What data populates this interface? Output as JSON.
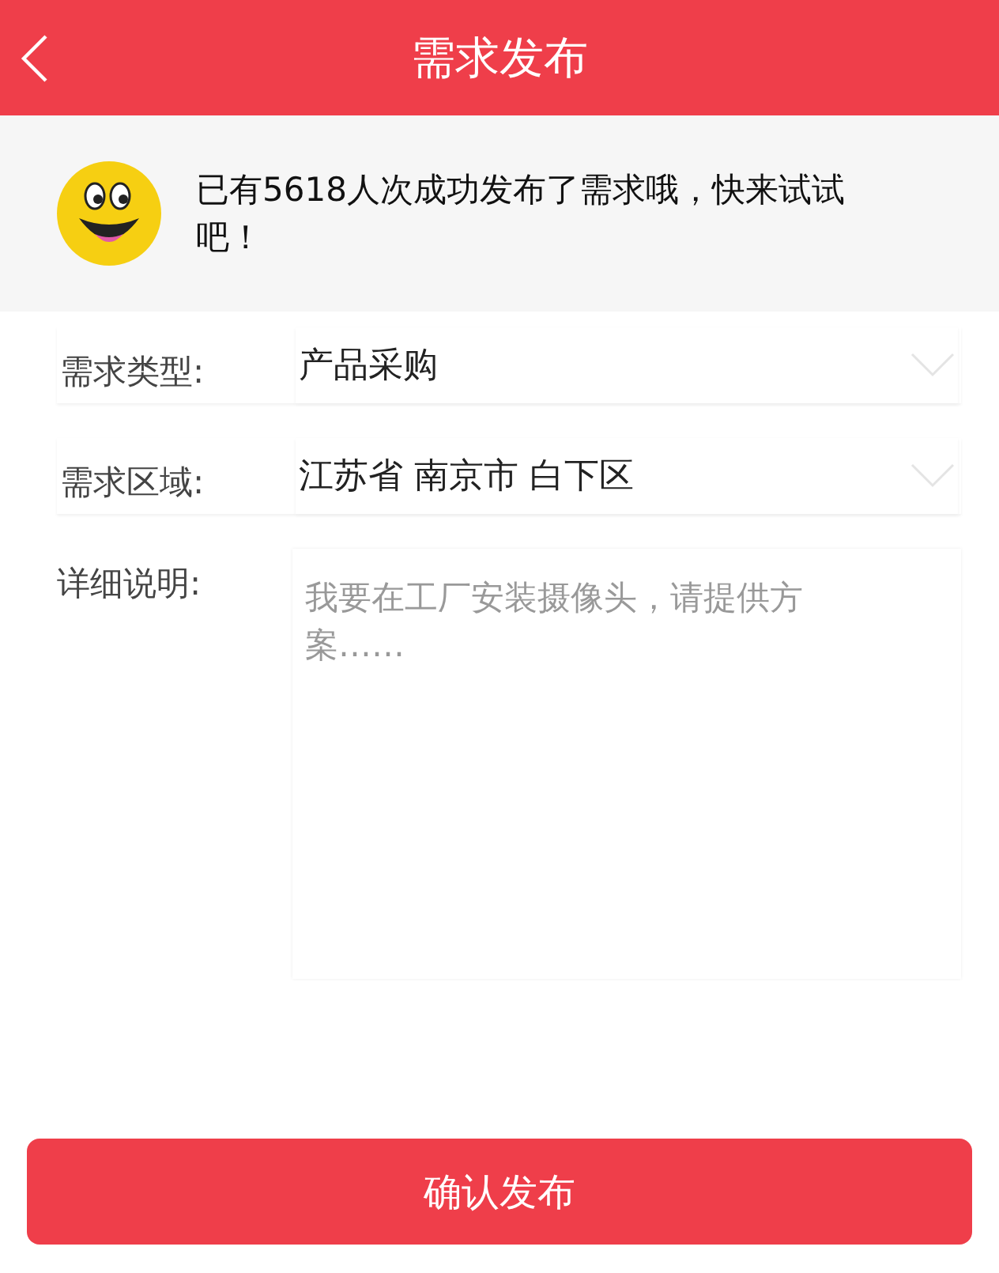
{
  "header": {
    "title": "需求发布"
  },
  "banner": {
    "text": "已有5618人次成功发布了需求哦，快来试试吧！"
  },
  "form": [
    {
      "kind": "select",
      "label": "需求类型:",
      "value": "产品采购"
    },
    {
      "kind": "select",
      "label": "需求区域:",
      "value": "江苏省 南京市 白下区"
    },
    {
      "kind": "textarea",
      "label": "详细说明:",
      "placeholder": "我要在工厂安装摄像头，请提供方案……"
    }
  ],
  "submit": "确认发布"
}
